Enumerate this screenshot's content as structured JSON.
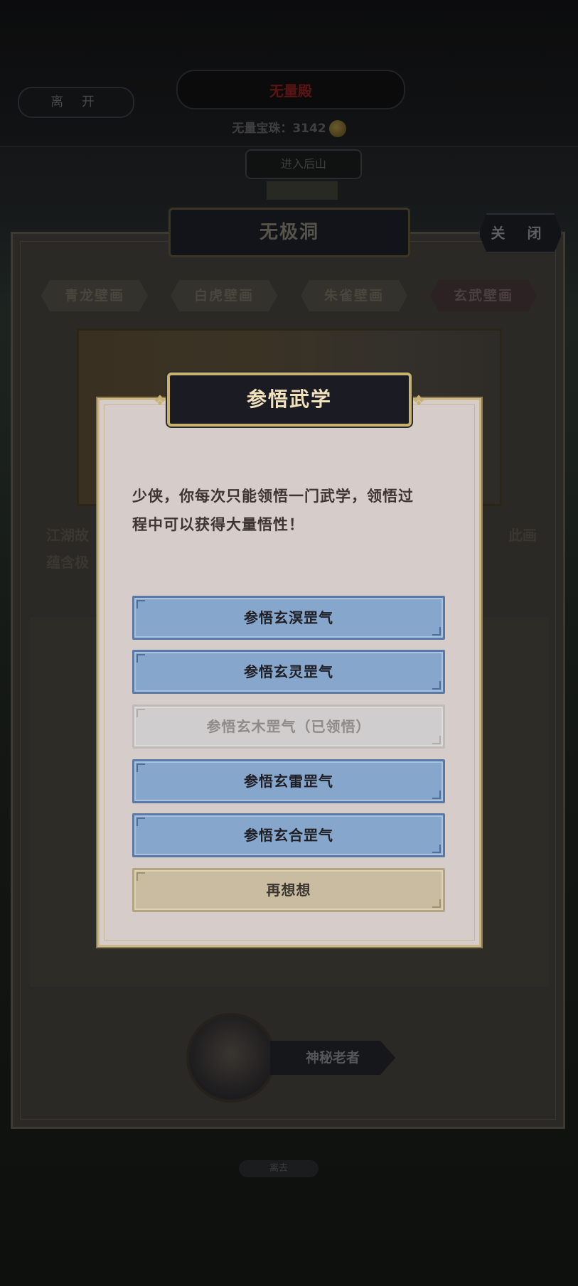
{
  "top_bar": {
    "leave_label": "离 开",
    "scene_title": "无量殿",
    "pearls_label": "无量宝珠：",
    "pearls_count": "3142",
    "enter_mountain_label": "进入后山"
  },
  "panel": {
    "title": "无极洞",
    "close_label": "关 闭",
    "tabs": [
      "青龙壁画",
      "白虎壁画",
      "朱雀壁画",
      "玄武壁画"
    ],
    "active_tab": "玄武壁画",
    "story_line1_start": "江湖故",
    "story_line1_end": "此画",
    "story_line2_start": "蕴含极",
    "npc_name": "神秘老者",
    "bottom_label": "离去"
  },
  "dialog": {
    "title": "参悟武学",
    "message_line1": "少侠，你每次只能领悟一门武学，领悟过",
    "message_line2": "程中可以获得大量悟性！",
    "options": [
      {
        "label": "参悟玄溟罡气",
        "state": "enabled"
      },
      {
        "label": "参悟玄灵罡气",
        "state": "enabled"
      },
      {
        "label": "参悟玄木罡气（已领悟）",
        "state": "disabled"
      },
      {
        "label": "参悟玄雷罡气",
        "state": "enabled"
      },
      {
        "label": "参悟玄合罡气",
        "state": "enabled"
      }
    ],
    "cancel_label": "再想想"
  },
  "colors": {
    "option_blue": "#86a6cc",
    "option_disabled": "#cfcdcd",
    "cancel_tan": "#c9bca0",
    "dialog_bg": "#d6cdcb",
    "title_gold": "#c8b171"
  }
}
